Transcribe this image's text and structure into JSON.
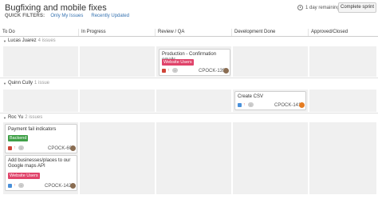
{
  "board": {
    "title": "Bugfixing and mobile fixes",
    "quick_filters_label": "QUICK FILTERS:",
    "filters": [
      "Only My Issues",
      "Recently Updated"
    ],
    "days_remaining": "1 day remaining",
    "complete_sprint": "Complete sprint"
  },
  "columns": [
    "To Do",
    "In Progress",
    "Review / QA",
    "Development Done",
    "Approved/Closed"
  ],
  "swimlanes": [
    {
      "name": "Lucas Juarez",
      "count": "4 issues",
      "cards": [
        {
          "summary": "Production - Confirmation emails",
          "label": "Website Users",
          "key": "CPOCK-139",
          "avatar": "avatar-icon"
        }
      ]
    },
    {
      "name": "Quinn Cully",
      "count": "1 issue",
      "cards": [
        {
          "summary": "Create CSV",
          "key": "CPOCK-141",
          "avatar": "avatar-icon"
        }
      ]
    },
    {
      "name": "Roc Yu",
      "count": "2 issues",
      "cards": [
        {
          "summary": "Payment fail indicators",
          "label": "Backend",
          "key": "CPOCK-60",
          "avatar": "avatar-icon"
        },
        {
          "summary_line1": "Add businesses/places to our",
          "summary_line2": "Google maps API",
          "label": "Website Users",
          "key": "CPOCK-142",
          "avatar": "avatar-icon"
        }
      ]
    }
  ],
  "colors": {
    "label_pink": "#e0436a",
    "label_green": "#3fa047",
    "link": "#3572b0",
    "cell_bg": "#f0f0f0"
  }
}
